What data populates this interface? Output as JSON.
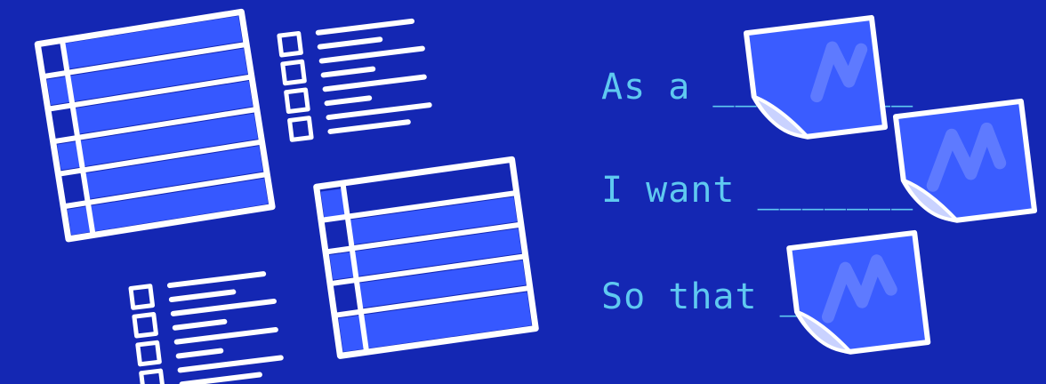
{
  "story": {
    "line1": "As a _________",
    "line2": "I want _______",
    "line3": "So that ______"
  },
  "colors": {
    "background": "#1427b3",
    "accent": "#3658ff",
    "outline": "#ffffff",
    "text": "#5fc9f0",
    "note_fill": "#3a5cff",
    "note_curl": "#c9d2ff"
  },
  "icons": [
    "table-doodle",
    "checklist-doodle",
    "sticky-note-icon"
  ]
}
